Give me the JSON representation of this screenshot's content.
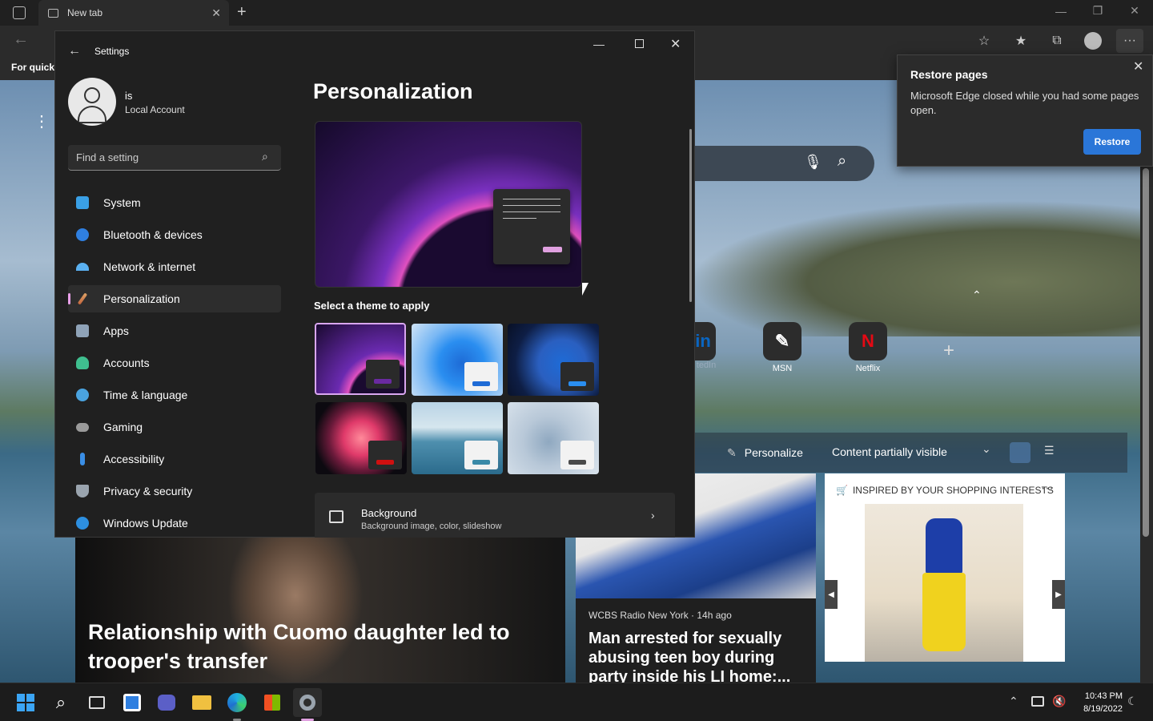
{
  "edge": {
    "tab_title": "New tab",
    "favbar_text": "For quick",
    "tiles": [
      {
        "label": "tedIn",
        "glyph": "in",
        "color": "#0a66c2"
      },
      {
        "label": "MSN",
        "glyph": "❤",
        "color": "#ffffff"
      },
      {
        "label": "Netflix",
        "glyph": "N",
        "color": "#e50914"
      }
    ],
    "feed": {
      "personalize": "Personalize",
      "visibility": "Content partially visible"
    },
    "restore_popup": {
      "title": "Restore pages",
      "message": "Microsoft Edge closed while you had some pages open.",
      "button": "Restore"
    },
    "news": [
      {
        "headline": "Relationship with Cuomo daughter led to trooper's transfer"
      },
      {
        "source": "WCBS Radio New York · 14h ago",
        "headline": "Man arrested for sexually abusing teen boy during party inside his LI home:..."
      }
    ],
    "shopping": {
      "label": "INSPIRED BY YOUR SHOPPING INTERESTS"
    }
  },
  "settings": {
    "title": "Settings",
    "account_name": "is",
    "account_type": "Local Account",
    "search_placeholder": "Find a setting",
    "nav": [
      {
        "label": "System",
        "color": "#3aa0e6"
      },
      {
        "label": "Bluetooth & devices",
        "color": "#2f7fe0"
      },
      {
        "label": "Network & internet",
        "color": "#5ab0f0"
      },
      {
        "label": "Personalization",
        "color": "#e0a86a"
      },
      {
        "label": "Apps",
        "color": "#8fa3b8"
      },
      {
        "label": "Accounts",
        "color": "#3fbf8f"
      },
      {
        "label": "Time & language",
        "color": "#4aa3df"
      },
      {
        "label": "Gaming",
        "color": "#9a9a9a"
      },
      {
        "label": "Accessibility",
        "color": "#3a8ee6"
      },
      {
        "label": "Privacy & security",
        "color": "#9aa4ae"
      },
      {
        "label": "Windows Update",
        "color": "#2d8fe0"
      }
    ],
    "selected_nav": "Personalization",
    "page_title": "Personalization",
    "theme_section": "Select a theme to apply",
    "background_title": "Background",
    "background_sub": "Background image, color, slideshow"
  },
  "taskbar": {
    "time": "10:43 PM",
    "date": "8/19/2022"
  }
}
